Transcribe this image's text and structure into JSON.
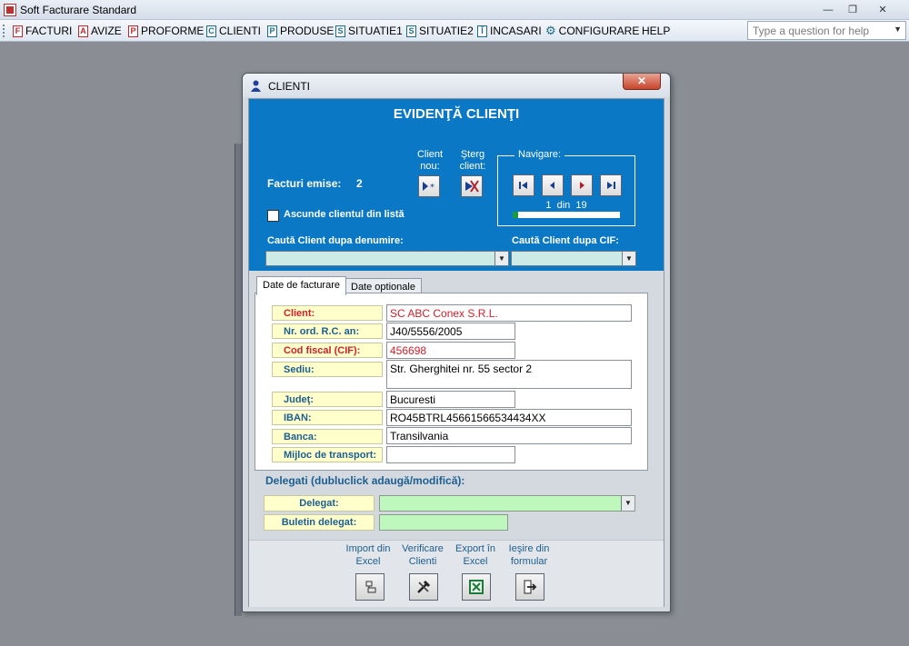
{
  "app": {
    "title": "Soft Facturare Standard",
    "controls": {
      "minimize": "—",
      "restore": "❐",
      "close": "✕"
    }
  },
  "menu": {
    "items": [
      {
        "label": "FACTURI",
        "icon": "invoice-icon",
        "glyph": "F"
      },
      {
        "label": "AVIZE",
        "icon": "notice-icon",
        "glyph": "A"
      },
      {
        "label": "PROFORME",
        "icon": "proforma-icon",
        "glyph": "P"
      },
      {
        "label": "CLIENTI",
        "icon": "clients-icon",
        "glyph": "C"
      },
      {
        "label": "PRODUSE",
        "icon": "products-icon",
        "glyph": "P"
      },
      {
        "label": "SITUATIE1",
        "icon": "report1-icon",
        "glyph": "S"
      },
      {
        "label": "SITUATIE2",
        "icon": "report2-icon",
        "glyph": "S"
      },
      {
        "label": "INCASARI",
        "icon": "payments-icon",
        "glyph": "Î"
      },
      {
        "label": "CONFIGURARE",
        "icon": "config-icon",
        "glyph": "⚙"
      },
      {
        "label": "HELP",
        "icon": "",
        "glyph": ""
      }
    ],
    "help_placeholder": "Type a question for help"
  },
  "dialog": {
    "title": "CLIENTI",
    "form_title": "EVIDENŢĂ CLIENŢI",
    "new_client_label": "Client nou:",
    "delete_client_label": "Şterg client:",
    "navigation_label": "Navigare:",
    "invoices_issued_label": "Facturi emise:",
    "invoices_issued_value": "2",
    "record_current": "1",
    "record_of": "din",
    "record_total": "19",
    "record_progress": 0.05,
    "hide_client_label": "Ascunde clientul din listă",
    "search_by_name_label": "Caută Client dupa denumire:",
    "search_by_cif_label": "Caută Client dupa CIF:",
    "search_by_name_value": "",
    "search_by_cif_value": "",
    "tabs": [
      {
        "label": "Date de facturare",
        "active": true
      },
      {
        "label": "Date optionale",
        "active": false
      }
    ],
    "fields": {
      "client": {
        "label": "Client:",
        "value": "SC ABC Conex S.R.L."
      },
      "reg_number": {
        "label": "Nr. ord. R.C. an:",
        "value": "J40/5556/2005"
      },
      "cif": {
        "label": "Cod fiscal (CIF):",
        "value": "456698"
      },
      "address": {
        "label": "Sediu:",
        "value": "Str. Gherghitei nr. 55 sector 2"
      },
      "county": {
        "label": "Judeţ:",
        "value": "Bucuresti"
      },
      "iban": {
        "label": "IBAN:",
        "value": "RO45BTRL45661566534434XX"
      },
      "bank": {
        "label": "Banca:",
        "value": "Transilvania"
      },
      "transport": {
        "label": "Mijloc de transport:",
        "value": ""
      }
    },
    "delegates": {
      "title": "Delegati (dubluclick adaugă/modifică):",
      "delegate_label": "Delegat:",
      "delegate_value": "",
      "id_label": "Buletin delegat:",
      "id_value": ""
    },
    "footer": {
      "import_label": "Import din Excel",
      "verify_label": "Verificare Clienti",
      "export_label": "Export în Excel",
      "exit_label": "Ieşire din formular"
    }
  },
  "colors": {
    "blue_panel": "#0b78c5",
    "label_background": "#ffffcc",
    "required_text": "#d0202a",
    "label_text": "#1b5e8f",
    "delegate_field": "#bff8bd"
  }
}
